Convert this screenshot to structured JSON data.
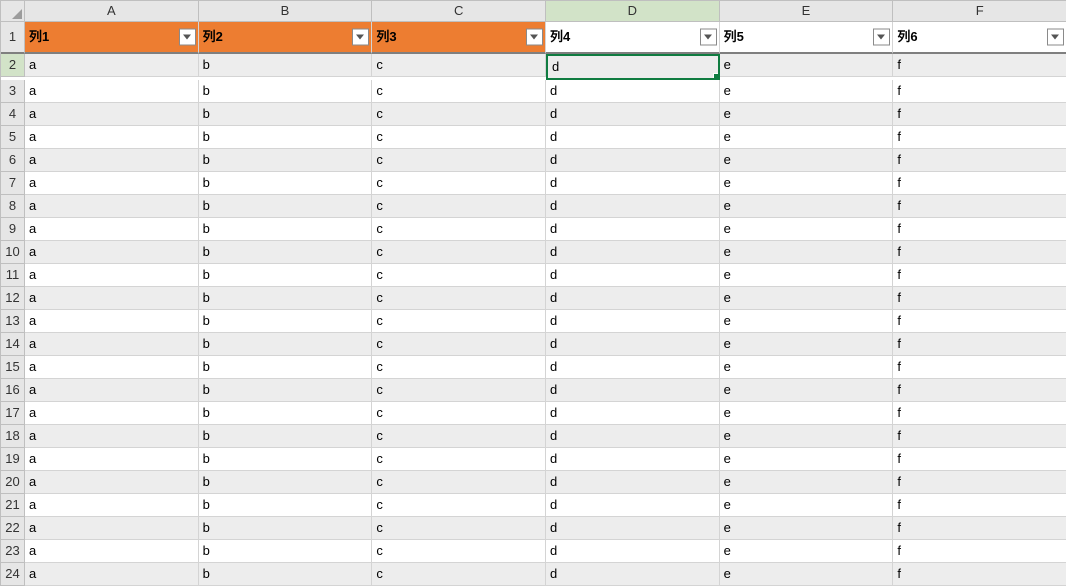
{
  "columns": [
    "A",
    "B",
    "C",
    "D",
    "E",
    "F"
  ],
  "row_numbers": [
    1,
    2,
    3,
    4,
    5,
    6,
    7,
    8,
    9,
    10,
    11,
    12,
    13,
    14,
    15,
    16,
    17,
    18,
    19,
    20,
    21,
    22,
    23,
    24
  ],
  "headers": [
    {
      "label": "列1",
      "style": "orange"
    },
    {
      "label": "列2",
      "style": "orange"
    },
    {
      "label": "列3",
      "style": "orange"
    },
    {
      "label": "列4",
      "style": "white"
    },
    {
      "label": "列5",
      "style": "white"
    },
    {
      "label": "列6",
      "style": "white"
    }
  ],
  "data_row": {
    "A": "a",
    "B": "b",
    "C": "c",
    "D": "d",
    "E": "e",
    "F": "f"
  },
  "data_row_count": 23,
  "selection": {
    "col": "D",
    "row": 2,
    "col_index": 3
  },
  "chart_data": {
    "type": "table",
    "columns": [
      "列1",
      "列2",
      "列3",
      "列4",
      "列5",
      "列6"
    ],
    "rows_preview": [
      [
        "a",
        "b",
        "c",
        "d",
        "e",
        "f"
      ]
    ],
    "rows_repeat": 23
  }
}
